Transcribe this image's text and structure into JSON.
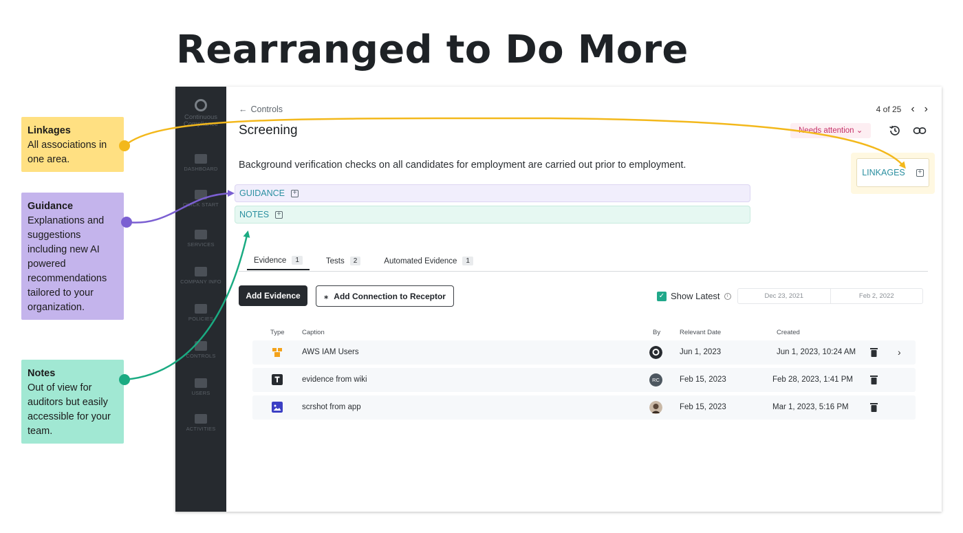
{
  "headline": "Rearranged to Do More",
  "callouts": {
    "linkages": {
      "title": "Linkages",
      "body": "All associations in one area.",
      "color": "#ffe082",
      "line_color": "#f3b81b"
    },
    "guidance": {
      "title": "Guidance",
      "body": "Explanations and suggestions including new AI powered recommendations tailored to your organization.",
      "color": "#c4b4ec",
      "line_color": "#7b5fd2"
    },
    "notes": {
      "title": "Notes",
      "body": "Out of view for auditors but easily accessible for your team.",
      "color": "#a1e8d3",
      "line_color": "#1aab82"
    }
  },
  "sidebar": {
    "logo_label": "Continuous Compliance",
    "items": [
      {
        "label": "DASHBOARD",
        "icon": "chart-icon"
      },
      {
        "label": "QUICK START",
        "icon": "rocket-icon"
      },
      {
        "label": "SERVICES",
        "icon": "services-icon"
      },
      {
        "label": "COMPANY INFO",
        "icon": "building-icon"
      },
      {
        "label": "POLICIES",
        "icon": "shield-icon"
      },
      {
        "label": "CONTROLS",
        "icon": "gear-icon"
      },
      {
        "label": "USERS",
        "icon": "users-icon"
      },
      {
        "label": "ACTIVITIES",
        "icon": "activity-icon"
      }
    ]
  },
  "header": {
    "back_label": "Controls",
    "pager_text": "4 of 25",
    "title": "Screening",
    "status": "Needs attention",
    "status_color": "#c42f66"
  },
  "description": "Background verification checks on all candidates for employment are carried out prior to employment.",
  "sections": {
    "guidance_label": "GUIDANCE",
    "notes_label": "NOTES",
    "linkages_label": "LINKAGES"
  },
  "tabs": [
    {
      "label": "Evidence",
      "count": "1",
      "active": true
    },
    {
      "label": "Tests",
      "count": "2",
      "active": false
    },
    {
      "label": "Automated Evidence",
      "count": "1",
      "active": false
    }
  ],
  "actions": {
    "add_evidence": "Add Evidence",
    "add_connection": "Add Connection to Receptor"
  },
  "filters": {
    "show_latest_label": "Show Latest",
    "show_latest_checked": true,
    "date_from": "Dec 23, 2021",
    "date_to": "Feb 2, 2022"
  },
  "table": {
    "columns": [
      "Type",
      "Caption",
      "By",
      "Relevant Date",
      "Created"
    ],
    "rows": [
      {
        "type_icon": "aws-icon",
        "caption": "AWS IAM Users",
        "by": "",
        "by_icon": "system-logo-avatar",
        "relevant_date": "Jun 1, 2023",
        "created": "Jun 1, 2023, 10:24 AM"
      },
      {
        "type_icon": "text-doc-icon",
        "caption": "evidence from wiki",
        "by": "RC",
        "by_icon": "initials-avatar",
        "relevant_date": "Feb 15, 2023",
        "created": "Feb 28, 2023, 1:41 PM"
      },
      {
        "type_icon": "image-icon",
        "caption": "scrshot from app",
        "by": "",
        "by_icon": "photo-avatar",
        "relevant_date": "Feb 15, 2023",
        "created": "Mar 1, 2023, 5:16 PM"
      }
    ]
  }
}
